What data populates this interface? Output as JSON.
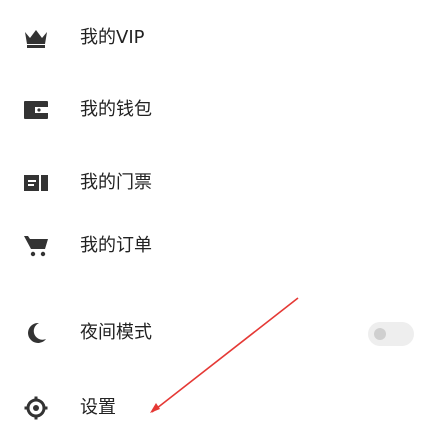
{
  "menu": {
    "items": [
      {
        "label": "我的VIP",
        "icon": "crown-icon"
      },
      {
        "label": "我的钱包",
        "icon": "wallet-icon"
      },
      {
        "label": "我的门票",
        "icon": "ticket-icon"
      },
      {
        "label": "我的订单",
        "icon": "cart-icon"
      },
      {
        "label": "夜间模式",
        "icon": "moon-icon",
        "toggle": false
      },
      {
        "label": "设置",
        "icon": "settings-gear-icon"
      }
    ]
  },
  "colors": {
    "icon": "#333333",
    "text": "#222222",
    "annotation": "#e53935"
  }
}
